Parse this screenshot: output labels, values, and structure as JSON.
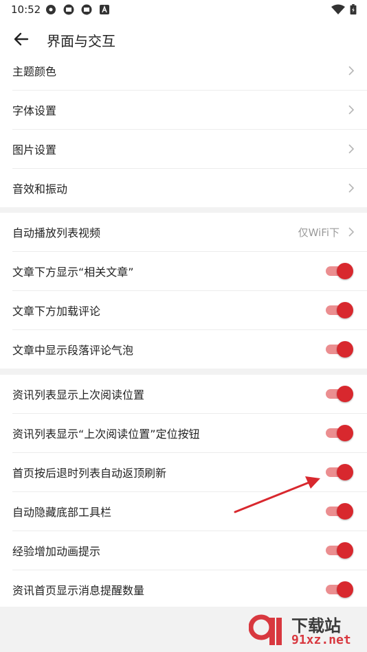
{
  "status_bar": {
    "time": "10:52",
    "icons": [
      "app-icon",
      "notification-icon",
      "notification-icon",
      "a-icon",
      "wifi-icon",
      "battery-icon"
    ]
  },
  "header": {
    "title": "界面与交互",
    "back_icon": "arrow-left-icon"
  },
  "sections": [
    {
      "rows": [
        {
          "label": "主题颜色",
          "control": "chevron"
        },
        {
          "label": "字体设置",
          "control": "chevron"
        },
        {
          "label": "图片设置",
          "control": "chevron"
        },
        {
          "label": "音效和振动",
          "control": "chevron"
        }
      ]
    },
    {
      "rows": [
        {
          "label": "自动播放列表视频",
          "value": "仅WiFi下",
          "control": "chevron"
        },
        {
          "label": "文章下方显示“相关文章”",
          "control": "toggle",
          "on": true
        },
        {
          "label": "文章下方加载评论",
          "control": "toggle",
          "on": true
        },
        {
          "label": "文章中显示段落评论气泡",
          "control": "toggle",
          "on": true
        }
      ]
    },
    {
      "rows": [
        {
          "label": "资讯列表显示上次阅读位置",
          "control": "toggle",
          "on": true
        },
        {
          "label": "资讯列表显示“上次阅读位置”定位按钮",
          "control": "toggle",
          "on": true
        },
        {
          "label": "首页按后退时列表自动返顶刷新",
          "control": "toggle",
          "on": true
        },
        {
          "label": "自动隐藏底部工具栏",
          "control": "toggle",
          "on": true
        },
        {
          "label": "经验增加动画提示",
          "control": "toggle",
          "on": true
        },
        {
          "label": "资讯首页显示消息提醒数量",
          "control": "toggle",
          "on": true
        }
      ]
    }
  ],
  "watermark": {
    "title": "下载站",
    "url": "91xz.net"
  },
  "colors": {
    "accent": "#d8282e",
    "track_on": "#eb8e90",
    "annotation_arrow": "#d8282e"
  }
}
